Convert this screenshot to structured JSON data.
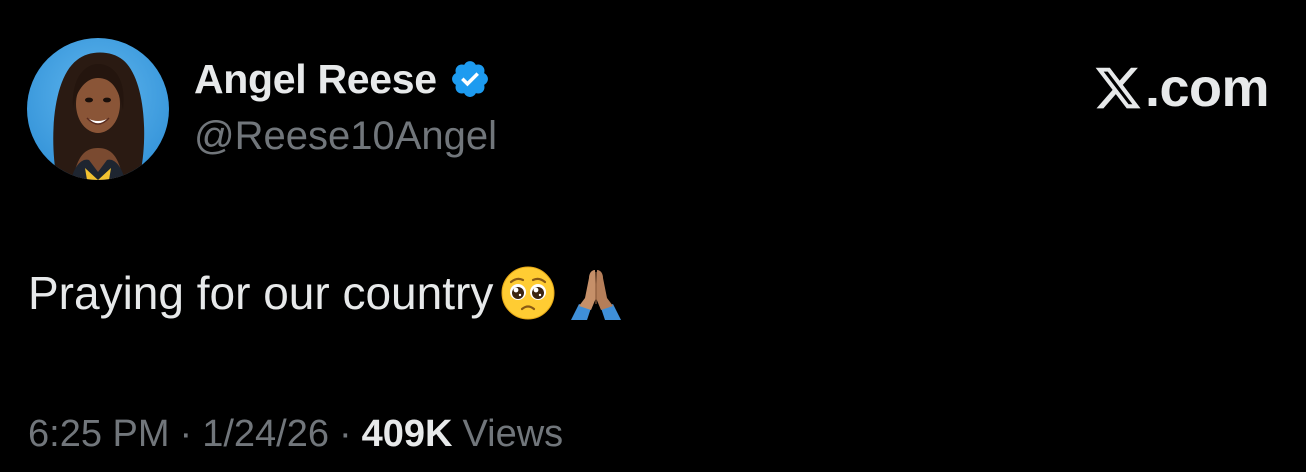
{
  "author": {
    "display_name": "Angel Reese",
    "handle": "@Reese10Angel",
    "verified": true,
    "verified_color": "#1d9bf0",
    "avatar_icon": "profile-photo"
  },
  "brand": {
    "logo_icon": "x-logo-icon",
    "text": ".com"
  },
  "tweet": {
    "text": "Praying for our country",
    "emojis": [
      "pleading-face-emoji",
      "folded-hands-emoji"
    ]
  },
  "meta": {
    "time": "6:25 PM",
    "separator": "·",
    "date": "1/24/26",
    "views_count": "409K",
    "views_label": "Views"
  },
  "colors": {
    "background": "#000000",
    "primary_text": "#e7e9ea",
    "secondary_text": "#71767b"
  }
}
